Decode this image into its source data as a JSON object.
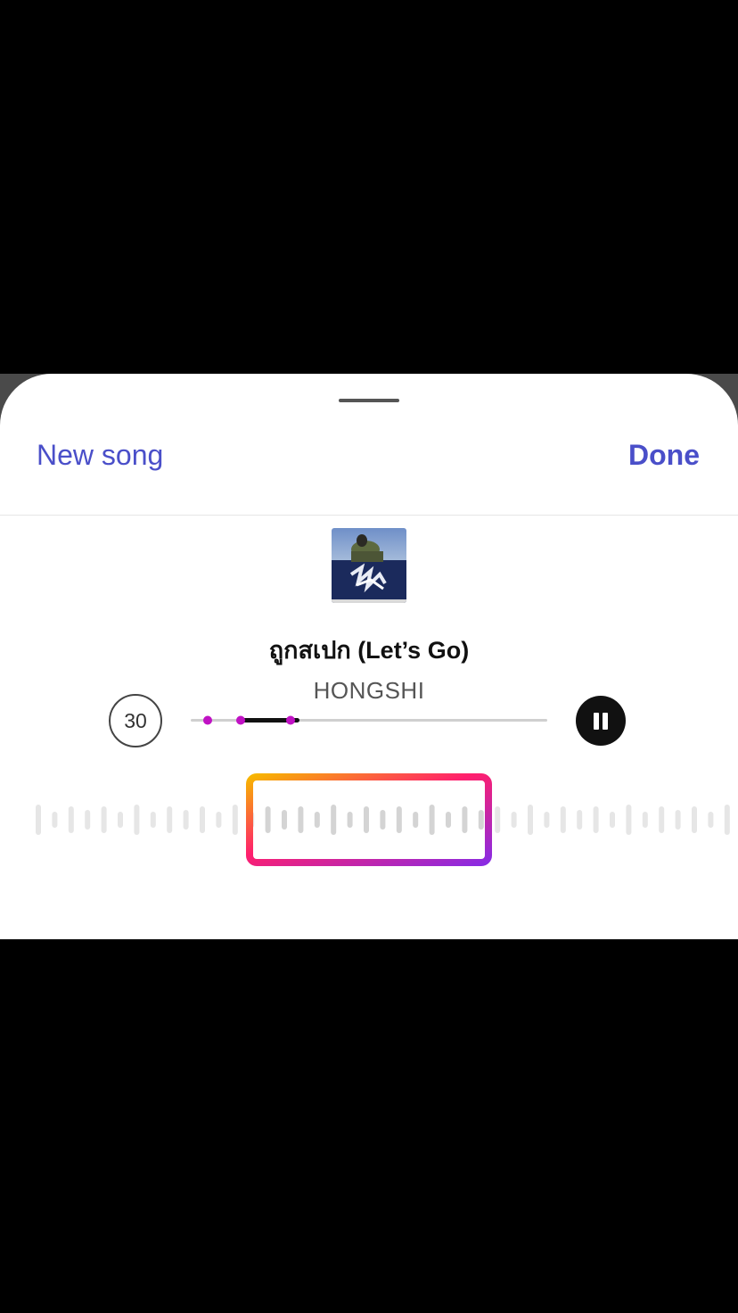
{
  "header": {
    "new_song_label": "New song",
    "done_label": "Done"
  },
  "track": {
    "title": "ถูกสเปก (Let’s Go)",
    "artist": "HONGSHI",
    "cover_icon": "album-cover-image"
  },
  "controls": {
    "duration_label": "30",
    "pause_icon": "pause-icon",
    "selection_fraction": [
      0.14,
      0.28
    ],
    "progress_fraction": 0.3
  },
  "colors": {
    "accent": "#4a4fc9",
    "gradient_start": "#f7b500",
    "gradient_mid": "#ff1f6d",
    "gradient_end": "#8a2be2",
    "marker": "#c012c4"
  }
}
